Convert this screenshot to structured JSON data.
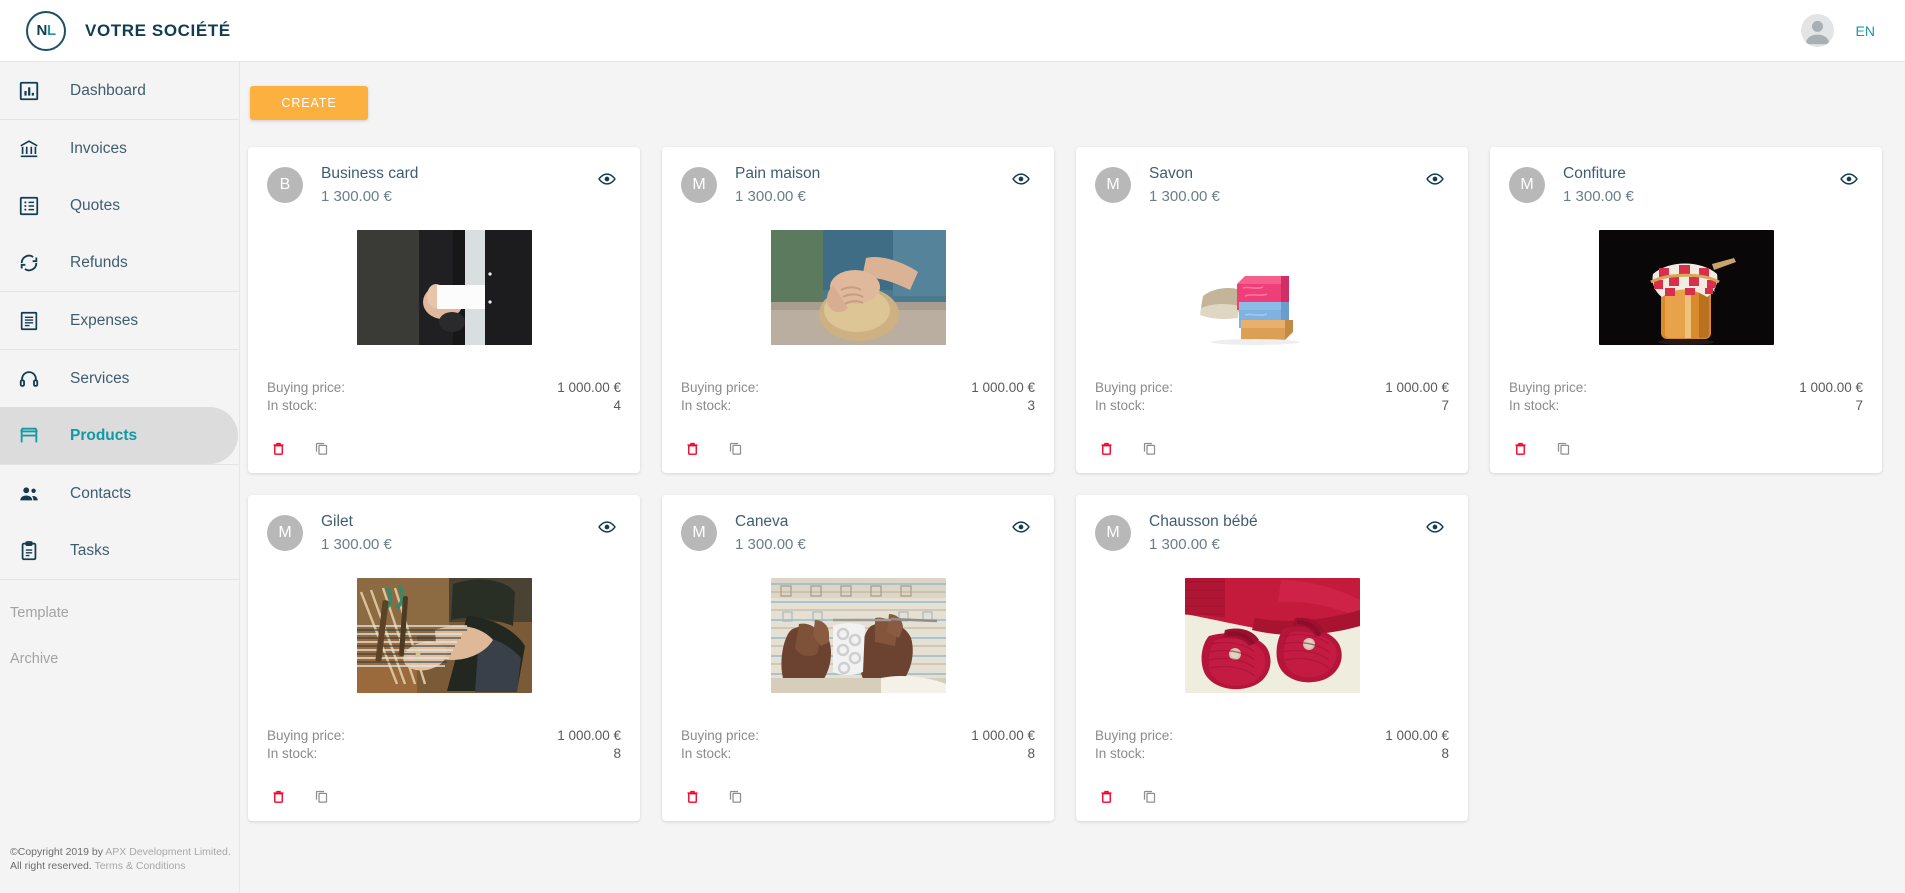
{
  "topbar": {
    "logo_initials_first": "N",
    "logo_initials_second": "L",
    "brand_title": "VOTRE SOCIÉTÉ",
    "language": "EN",
    "avatar_icon": "user-avatar-icon"
  },
  "sidebar": {
    "groups": [
      {
        "items": [
          {
            "label": "Dashboard",
            "icon": "bar-chart-icon",
            "active": false
          }
        ]
      },
      {
        "items": [
          {
            "label": "Invoices",
            "icon": "bank-icon",
            "active": false
          },
          {
            "label": "Quotes",
            "icon": "list-box-icon",
            "active": false
          },
          {
            "label": "Refunds",
            "icon": "refresh-icon",
            "active": false
          }
        ]
      },
      {
        "items": [
          {
            "label": "Expenses",
            "icon": "receipt-icon",
            "active": false
          }
        ]
      },
      {
        "items": [
          {
            "label": "Services",
            "icon": "headset-icon",
            "active": false
          },
          {
            "label": "Products",
            "icon": "store-icon",
            "active": true
          }
        ]
      },
      {
        "items": [
          {
            "label": "Contacts",
            "icon": "people-icon",
            "active": false
          },
          {
            "label": "Tasks",
            "icon": "clipboard-icon",
            "active": false
          }
        ]
      }
    ],
    "secondary_items": [
      {
        "label": "Template"
      },
      {
        "label": "Archive"
      }
    ]
  },
  "footer": {
    "copyright_prefix": "©Copyright 2019 by ",
    "company": "APX Development Limited.",
    "rights": "All right reserved.",
    "terms": "Terms & Conditions"
  },
  "toolbar": {
    "create_label": "CREATE"
  },
  "labels": {
    "buying_price": "Buying price:",
    "in_stock": "In stock:",
    "view_icon": "eye-icon",
    "delete_icon": "trash-icon",
    "duplicate_icon": "copy-icon"
  },
  "products": [
    {
      "avatar_letter": "B",
      "title": "Business card",
      "price": "1 300.00 €",
      "buying_price": "1 000.00 €",
      "in_stock": "4",
      "image": "man-in-suit-holding-blank-business-card"
    },
    {
      "avatar_letter": "M",
      "title": "Pain maison",
      "price": "1 300.00 €",
      "buying_price": "1 000.00 €",
      "in_stock": "3",
      "image": "hands-kneading-bread-dough"
    },
    {
      "avatar_letter": "M",
      "title": "Savon",
      "price": "1 300.00 €",
      "buying_price": "1 000.00 €",
      "in_stock": "7",
      "image": "stacked-pink-blue-tan-soap-bars-with-knitted-cloth"
    },
    {
      "avatar_letter": "M",
      "title": "Confiture",
      "price": "1 300.00 €",
      "buying_price": "1 000.00 €",
      "in_stock": "7",
      "image": "jam-jar-with-red-checkered-cloth-lid"
    },
    {
      "avatar_letter": "M",
      "title": "Gilet",
      "price": "1 300.00 €",
      "buying_price": "1 000.00 €",
      "in_stock": "8",
      "image": "person-weaving-on-loom"
    },
    {
      "avatar_letter": "M",
      "title": "Caneva",
      "price": "1 300.00 €",
      "buying_price": "1 000.00 €",
      "in_stock": "8",
      "image": "hands-crocheting-white-lace"
    },
    {
      "avatar_letter": "M",
      "title": "Chausson bébé",
      "price": "1 300.00 €",
      "buying_price": "1 000.00 €",
      "in_stock": "8",
      "image": "red-knitted-baby-booties"
    }
  ],
  "colors": {
    "accent_teal": "#0f9aa5",
    "navy": "#123c52",
    "create_orange": "#fbb03f",
    "delete_red": "#f6002a",
    "page_bg": "#f4f4f4"
  }
}
